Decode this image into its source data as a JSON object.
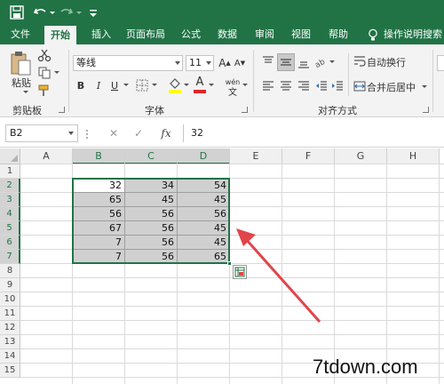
{
  "quick_access": {
    "save": "save-icon",
    "undo": "undo-icon",
    "redo": "redo-icon"
  },
  "tabs": [
    {
      "label": "文件",
      "active": false
    },
    {
      "label": "开始",
      "active": true
    },
    {
      "label": "插入",
      "active": false
    },
    {
      "label": "页面布局",
      "active": false
    },
    {
      "label": "公式",
      "active": false
    },
    {
      "label": "数据",
      "active": false
    },
    {
      "label": "审阅",
      "active": false
    },
    {
      "label": "视图",
      "active": false
    },
    {
      "label": "帮助",
      "active": false
    }
  ],
  "tell_me": "操作说明搜索",
  "ribbon": {
    "paste_label": "粘贴",
    "clipboard_label": "剪贴板",
    "font_name": "等线",
    "font_size": "11",
    "font_label": "字体",
    "bold": "B",
    "italic": "I",
    "underline": "U",
    "wrap_text": "自动换行",
    "merge_center": "合并后居中",
    "alignment_label": "对齐方式",
    "grow_font": "A",
    "shrink_font": "A",
    "font_color_letter": "A",
    "phonetic": "wén"
  },
  "formula_bar": {
    "name_box": "B2",
    "fx": "fx",
    "formula": "32"
  },
  "sheet": {
    "columns": [
      "A",
      "B",
      "C",
      "D",
      "E",
      "F",
      "G",
      "H"
    ],
    "selected_columns": [
      "B",
      "C",
      "D"
    ],
    "rows": [
      "1",
      "2",
      "3",
      "4",
      "5",
      "6",
      "7",
      "8",
      "9",
      "10",
      "11",
      "12",
      "13",
      "14",
      "15"
    ],
    "selected_rows": [
      "2",
      "3",
      "4",
      "5",
      "6",
      "7"
    ],
    "data": [
      [
        "32",
        "34",
        "54"
      ],
      [
        "65",
        "45",
        "45"
      ],
      [
        "56",
        "56",
        "56"
      ],
      [
        "67",
        "56",
        "45"
      ],
      [
        "7",
        "56",
        "45"
      ],
      [
        "7",
        "56",
        "65"
      ]
    ]
  },
  "watermark": "7tdown.com",
  "colors": {
    "accent": "#217346",
    "arrow": "#e0454a"
  }
}
